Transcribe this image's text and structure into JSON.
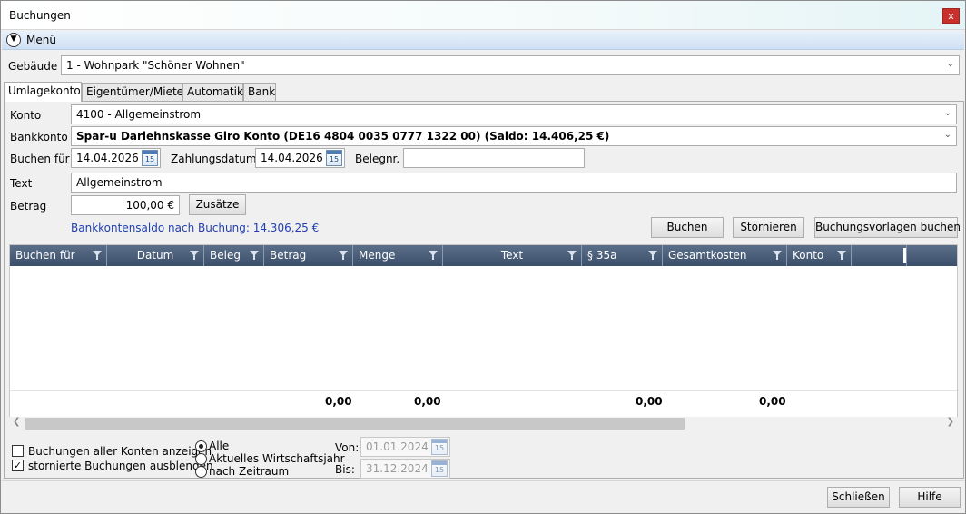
{
  "window": {
    "title": "Buchungen",
    "close_label": "x"
  },
  "menu": {
    "label": "Menü",
    "toggle_icon": "chevron-down-circle-icon"
  },
  "gebaeude": {
    "label": "Gebäude",
    "value": "1 - Wohnpark \"Schöner Wohnen\""
  },
  "tabs": [
    {
      "label": "Umlagekonto",
      "active": true
    },
    {
      "label": "Eigentümer/Mieter",
      "active": false
    },
    {
      "label": "Automatik",
      "active": false
    },
    {
      "label": "Bank",
      "active": false
    }
  ],
  "form": {
    "konto_label": "Konto",
    "konto_value": "4100 - Allgemeinstrom",
    "bankkonto_label": "Bankkonto",
    "bankkonto_value": "Spar-u Darlehnskasse Giro Konto (DE16 4804 0035 0777 1322 00) (Saldo: 14.406,25 €)",
    "buchen_fuer_label": "Buchen für",
    "buchen_fuer_value": "14.04.2026",
    "zahlungsdatum_label": "Zahlungsdatum",
    "zahlungsdatum_value": "14.04.2026",
    "belegnr_label": "Belegnr.",
    "belegnr_value": "",
    "calendar_icon_text": "15",
    "text_label": "Text",
    "text_value": "Allgemeinstrom",
    "betrag_label": "Betrag",
    "betrag_value": "100,00 €",
    "zusaetze_label": "Zusätze",
    "saldo_text": "Bankkontensaldo nach Buchung: 14.306,25 €"
  },
  "actions": {
    "buchen": "Buchen",
    "stornieren": "Stornieren",
    "vorlagen": "Buchungsvorlagen buchen"
  },
  "grid": {
    "columns": [
      "Buchen für",
      "Datum",
      "Beleg",
      "Betrag",
      "Menge",
      "Text",
      "§ 35a",
      "Gesamtkosten",
      "Konto"
    ],
    "sums": {
      "betrag": "0,00",
      "menge": "0,00",
      "p35a": "0,00",
      "gesamtkosten": "0,00"
    }
  },
  "filters": {
    "alle_konten_label": "Buchungen aller Konten anzeigen",
    "alle_konten_checked": false,
    "storniert_label": "stornierte Buchungen ausblenden",
    "storniert_checked": true,
    "radio_alle": "Alle",
    "radio_wirtschaftsjahr": "Aktuelles Wirtschaftsjahr",
    "radio_zeitraum": "nach Zeitraum",
    "selected_radio": "Alle",
    "von_label": "Von:",
    "von_value": "01.01.2024",
    "bis_label": "Bis:",
    "bis_value": "31.12.2024"
  },
  "footer": {
    "schliessen": "Schließen",
    "hilfe": "Hilfe"
  }
}
